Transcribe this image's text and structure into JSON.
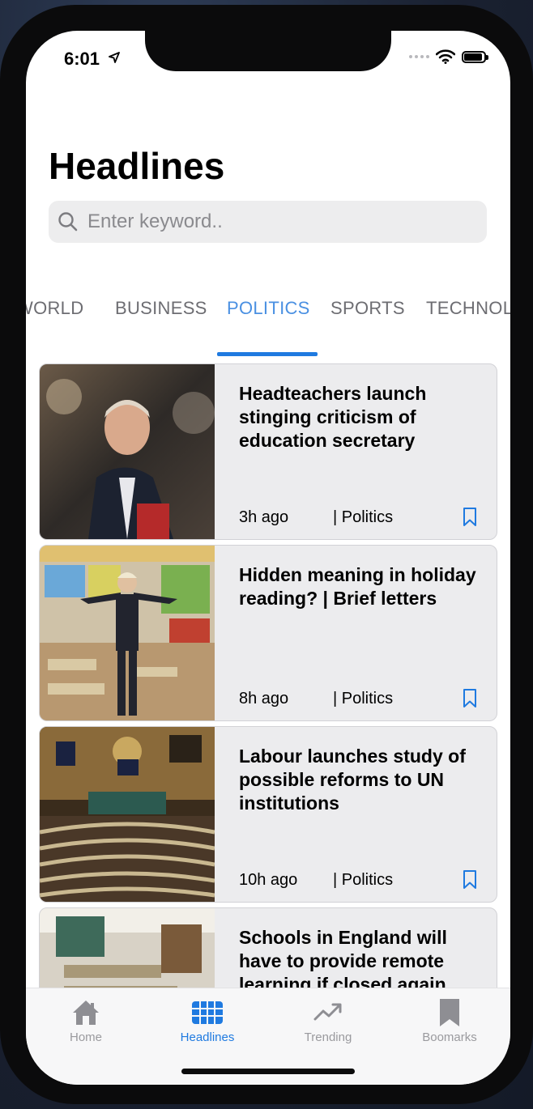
{
  "status_bar": {
    "time": "6:01"
  },
  "header": {
    "title": "Headlines"
  },
  "search": {
    "placeholder": "Enter keyword.."
  },
  "category_tabs": [
    {
      "label": "WORLD"
    },
    {
      "label": "BUSINESS"
    },
    {
      "label": "POLITICS",
      "active": true
    },
    {
      "label": "SPORTS"
    },
    {
      "label": "TECHNOLOGY"
    }
  ],
  "articles": [
    {
      "title": "Headteachers launch stinging criticism of education secretary",
      "time": "3h ago",
      "category": "| Politics"
    },
    {
      "title": "Hidden meaning in holiday reading? | Brief letters",
      "time": "8h ago",
      "category": "| Politics"
    },
    {
      "title": "Labour launches study of possible reforms to UN institutions",
      "time": "10h ago",
      "category": "| Politics"
    },
    {
      "title": "Schools in England will have to provide remote learning if closed again",
      "time": "",
      "category": ""
    }
  ],
  "tab_bar": {
    "items": [
      {
        "label": "Home",
        "icon": "home-icon"
      },
      {
        "label": "Headlines",
        "icon": "grid-icon",
        "active": true
      },
      {
        "label": "Trending",
        "icon": "trending-icon"
      },
      {
        "label": "Boomarks",
        "icon": "bookmark-icon"
      }
    ]
  },
  "colors": {
    "accent": "#1f7ae0",
    "active_tab_text": "#4a90e2",
    "card_bg": "#ececee"
  }
}
